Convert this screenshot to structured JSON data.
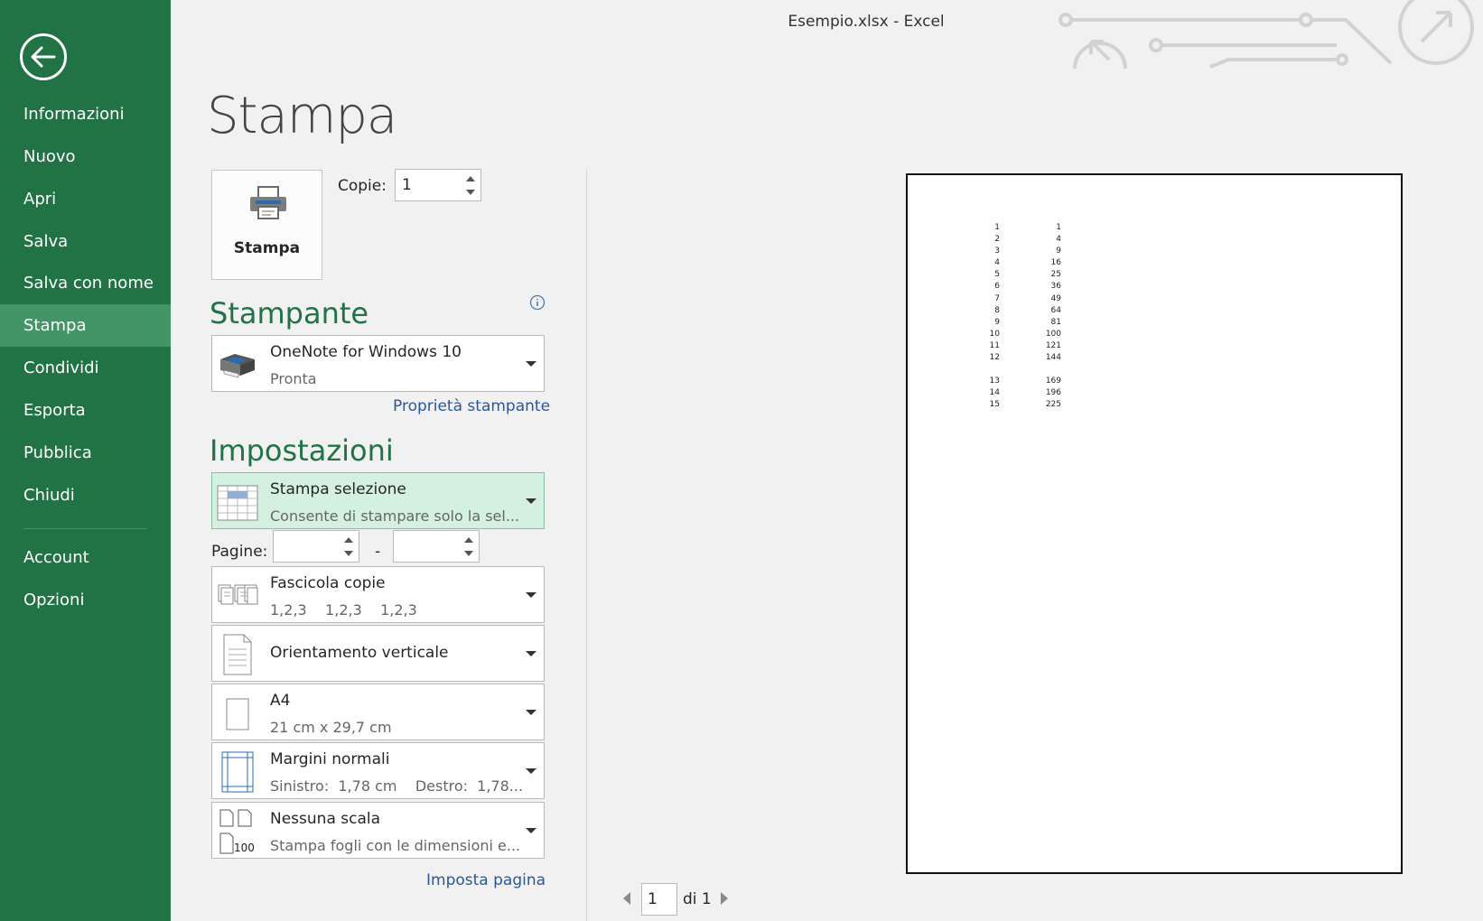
{
  "window": {
    "title": "Esempio.xlsx - Excel"
  },
  "sidebar": {
    "items": [
      {
        "label": "Informazioni"
      },
      {
        "label": "Nuovo"
      },
      {
        "label": "Apri"
      },
      {
        "label": "Salva"
      },
      {
        "label": "Salva con nome"
      },
      {
        "label": "Stampa",
        "active": true
      },
      {
        "label": "Condividi"
      },
      {
        "label": "Esporta"
      },
      {
        "label": "Pubblica"
      },
      {
        "label": "Chiudi"
      }
    ],
    "bottom_items": [
      {
        "label": "Account"
      },
      {
        "label": "Opzioni"
      }
    ]
  },
  "main": {
    "title": "Stampa",
    "print_button_label": "Stampa",
    "copies": {
      "label": "Copie:",
      "value": "1"
    },
    "printer_section": {
      "title": "Stampante",
      "name": "OneNote for Windows 10",
      "status": "Pronta",
      "properties_link": "Proprietà stampante"
    },
    "settings_section": {
      "title": "Impostazioni",
      "what": {
        "title": "Stampa selezione",
        "subtitle": "Consente di stampare solo la sel..."
      },
      "pages": {
        "label": "Pagine:",
        "from": "",
        "to": "",
        "separator": "-"
      },
      "collate": {
        "title": "Fascicola copie",
        "subtitle": "1,2,3    1,2,3    1,2,3"
      },
      "orientation": {
        "title": "Orientamento verticale"
      },
      "paper": {
        "title": "A4",
        "subtitle": "21 cm x 29,7 cm"
      },
      "margins": {
        "title": "Margini normali",
        "subtitle": "Sinistro:  1,78 cm    Destro:  1,78..."
      },
      "scaling": {
        "title": "Nessuna scala",
        "subtitle": "Stampa fogli con le dimensioni e...",
        "icon_text": "100"
      },
      "page_setup_link": "Imposta pagina"
    }
  },
  "preview": {
    "rows": [
      [
        "1",
        "1"
      ],
      [
        "2",
        "4"
      ],
      [
        "3",
        "9"
      ],
      [
        "4",
        "16"
      ],
      [
        "5",
        "25"
      ],
      [
        "6",
        "36"
      ],
      [
        "7",
        "49"
      ],
      [
        "8",
        "64"
      ],
      [
        "9",
        "81"
      ],
      [
        "10",
        "100"
      ],
      [
        "11",
        "121"
      ],
      [
        "12",
        "144"
      ],
      [
        "13",
        "169"
      ],
      [
        "14",
        "196"
      ],
      [
        "15",
        "225"
      ]
    ],
    "current_page": "1",
    "of_label": "di 1"
  },
  "colors": {
    "sidebar_bg": "#217346",
    "sidebar_active": "#439467",
    "accent": "#217346",
    "link": "#2b579a",
    "highlight": "#d3f0e0"
  }
}
